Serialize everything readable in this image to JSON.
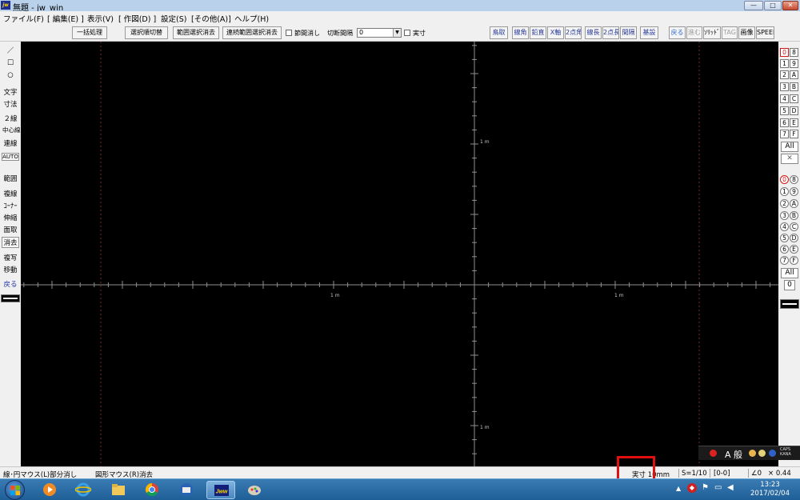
{
  "window": {
    "title": "無題 - jw_win",
    "app_icon_text": "jw",
    "minimize": "—",
    "maximize": "□",
    "close": "✕"
  },
  "menu": [
    "ファイル(F)",
    "[ 編集(E) ]",
    "表示(V)",
    "[ 作図(D) ]",
    "設定(S)",
    "[その他(A)]",
    "ヘルプ(H)"
  ],
  "toolbar": {
    "buttons_left": [
      "一括処理",
      "選択順切替",
      "範囲選択消去",
      "連続範囲選択消去"
    ],
    "check_setsudan": "節間消し",
    "label_kankaku": "切断間隔",
    "combo_value": "0",
    "check_jissun": "実寸",
    "buttons_right": [
      "鳥取",
      "線角",
      "鉛直",
      "X軸",
      "2点角",
      "線長",
      "2点長",
      "間隔",
      "基設"
    ],
    "buttons_far": [
      "戻る",
      "進む",
      "ｿﾘｯﾄﾞ",
      "TAG",
      "画像",
      "SPEED"
    ]
  },
  "left_tools": [
    "／",
    "□",
    "○",
    "文字",
    "寸法",
    "２線",
    "中心線",
    "連線",
    "AUTO",
    "範囲",
    "複線",
    "ｺｰﾅｰ",
    "伸縮",
    "面取",
    "消去",
    "複写",
    "移動",
    "戻る"
  ],
  "canvas": {
    "axis_label": "1 m",
    "background": "#000000",
    "axis_color": "#909090",
    "guide_color": "#7a2a2a"
  },
  "right_panel": {
    "layer_rows": [
      [
        "0",
        "8"
      ],
      [
        "1",
        "9"
      ],
      [
        "2",
        "A"
      ],
      [
        "3",
        "B"
      ],
      [
        "4",
        "C"
      ],
      [
        "5",
        "D"
      ],
      [
        "6",
        "E"
      ],
      [
        "7",
        "F"
      ]
    ],
    "all_label": "All",
    "cross_label": "✕",
    "group_rows": [
      [
        "0",
        "8"
      ],
      [
        "1",
        "9"
      ],
      [
        "2",
        "A"
      ],
      [
        "3",
        "B"
      ],
      [
        "4",
        "C"
      ],
      [
        "5",
        "D"
      ],
      [
        "6",
        "E"
      ],
      [
        "7",
        "F"
      ]
    ],
    "group_all_label": "All",
    "group_zero_label": "0"
  },
  "ime": {
    "mode": "A 般",
    "options": [
      "CAPS",
      "KANA"
    ]
  },
  "status": {
    "left_hint": "線･円マウス(L)部分消し",
    "right_hint": "図形マウス(R)消去",
    "jissun": "実寸 10mm",
    "scale": "S=1/10",
    "layer": "[0-0]",
    "angle": "∠0",
    "zoom": "× 0.44"
  },
  "taskbar": {
    "apps": [
      "windows-media-player",
      "internet-explorer",
      "file-explorer",
      "chrome",
      "thunderbird",
      "jw-cad",
      "paint"
    ],
    "active_app": "jw-cad",
    "jw_label": "Jww",
    "time": "13:23",
    "date": "2017/02/04"
  }
}
